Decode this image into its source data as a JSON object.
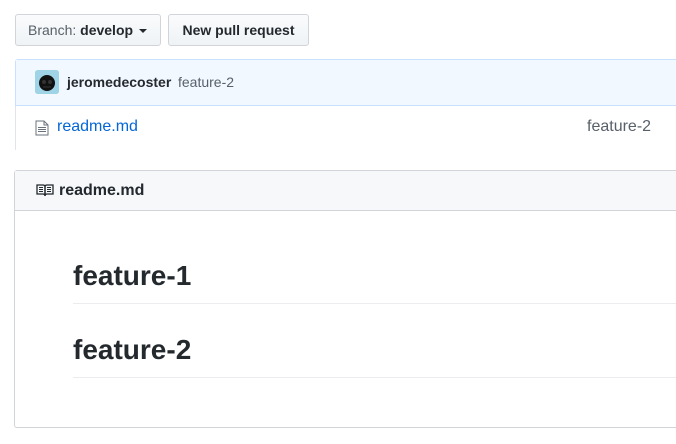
{
  "toolbar": {
    "branch_prefix": "Branch:",
    "branch_name": "develop",
    "new_pr_label": "New pull request"
  },
  "commit": {
    "author": "jeromedecoster",
    "message": "feature-2"
  },
  "files": [
    {
      "name": "readme.md",
      "last_commit": "feature-2",
      "icon": "file-text-icon"
    }
  ],
  "readme": {
    "title": "readme.md",
    "headings": [
      "feature-1",
      "feature-2"
    ]
  },
  "colors": {
    "link": "#0366d6",
    "commit_bar_bg": "#f1f8ff",
    "muted_text": "#586069"
  }
}
